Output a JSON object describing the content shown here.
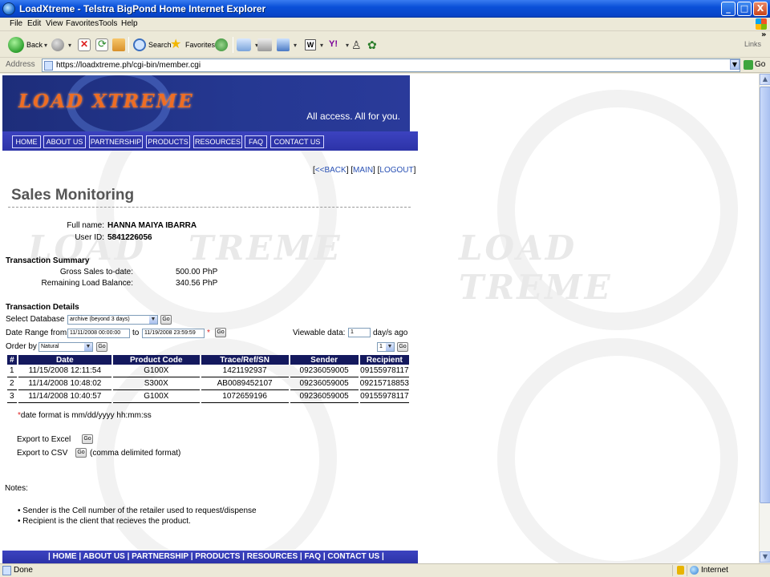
{
  "window": {
    "title": "LoadXtreme - Telstra BigPond Home Internet Explorer",
    "controls": {
      "minimize": "_",
      "maximize": "□",
      "close": "X"
    }
  },
  "menu": [
    "File",
    "Edit",
    "View",
    "Favorites",
    "Tools",
    "Help"
  ],
  "toolbar": {
    "back_label": "Back",
    "search_label": "Search",
    "favorites_label": "Favorites",
    "links_label": "Links"
  },
  "address": {
    "label": "Address",
    "url": "https://loadxtreme.ph/cgi-bin/member.cgi",
    "go_label": "Go"
  },
  "banner": {
    "logo_text": "LOAD XTREME",
    "tagline": "All access. All for you."
  },
  "nav": [
    "HOME",
    "ABOUT US",
    "PARTNERSHIP",
    "PRODUCTS",
    "RESOURCES",
    "FAQ",
    "CONTACT US"
  ],
  "top_links": {
    "back": "<<BACK",
    "main": "MAIN",
    "logout": "LOGOUT"
  },
  "page_title": "Sales Monitoring",
  "user": {
    "full_name_label": "Full name:",
    "full_name": "HANNA MAIYA IBARRA",
    "user_id_label": "User ID:",
    "user_id": "5841226056"
  },
  "summary": {
    "title": "Transaction Summary",
    "gross_label": "Gross Sales to-date:",
    "gross_value": "500.00 PhP",
    "balance_label": "Remaining Load Balance:",
    "balance_value": "340.56 PhP"
  },
  "details": {
    "title": "Transaction Details",
    "select_db_label": "Select Database",
    "select_db_value": "archive (beyond 3 days)",
    "date_range_label": "Date Range from",
    "date_from": "11/11/2008 00:00:00",
    "to_label": "to",
    "date_to": "11/19/2008 23:59:59",
    "required_mark": "*",
    "viewable_label": "Viewable data:",
    "viewable_value": "1",
    "viewable_unit": "day/s ago",
    "order_label": "Order by",
    "order_value": "Natural",
    "page_select": "1",
    "go": "Go"
  },
  "table": {
    "headers": [
      "#",
      "Date",
      "Product Code",
      "Trace/Ref/SN",
      "Sender",
      "Recipient"
    ],
    "rows": [
      [
        "1",
        "11/15/2008 12:11:54",
        "G100X",
        "1421192937",
        "09236059005",
        "09155978117"
      ],
      [
        "2",
        "11/14/2008 10:48:02",
        "S300X",
        "AB0089452107",
        "09236059005",
        "09215718853"
      ],
      [
        "3",
        "11/14/2008 10:40:57",
        "G100X",
        "1072659196",
        "09236059005",
        "09155978117"
      ]
    ]
  },
  "date_note": {
    "star": "*",
    "text": "date format is mm/dd/yyyy hh:mm:ss"
  },
  "export": {
    "excel_label": "Export to Excel",
    "csv_label": "Export to CSV",
    "csv_note": "(comma delimited format)",
    "go": "Go"
  },
  "notes": {
    "title": "Notes:",
    "items": [
      "Sender is the Cell number of the retailer used to request/dispense",
      "Recipient is the client that recieves the product."
    ]
  },
  "bottom_nav": [
    "HOME",
    "ABOUT US",
    "PARTNERSHIP",
    "PRODUCTS",
    "RESOURCES",
    "FAQ",
    "CONTACT US"
  ],
  "status": {
    "text": "Done",
    "zone": "Internet"
  }
}
